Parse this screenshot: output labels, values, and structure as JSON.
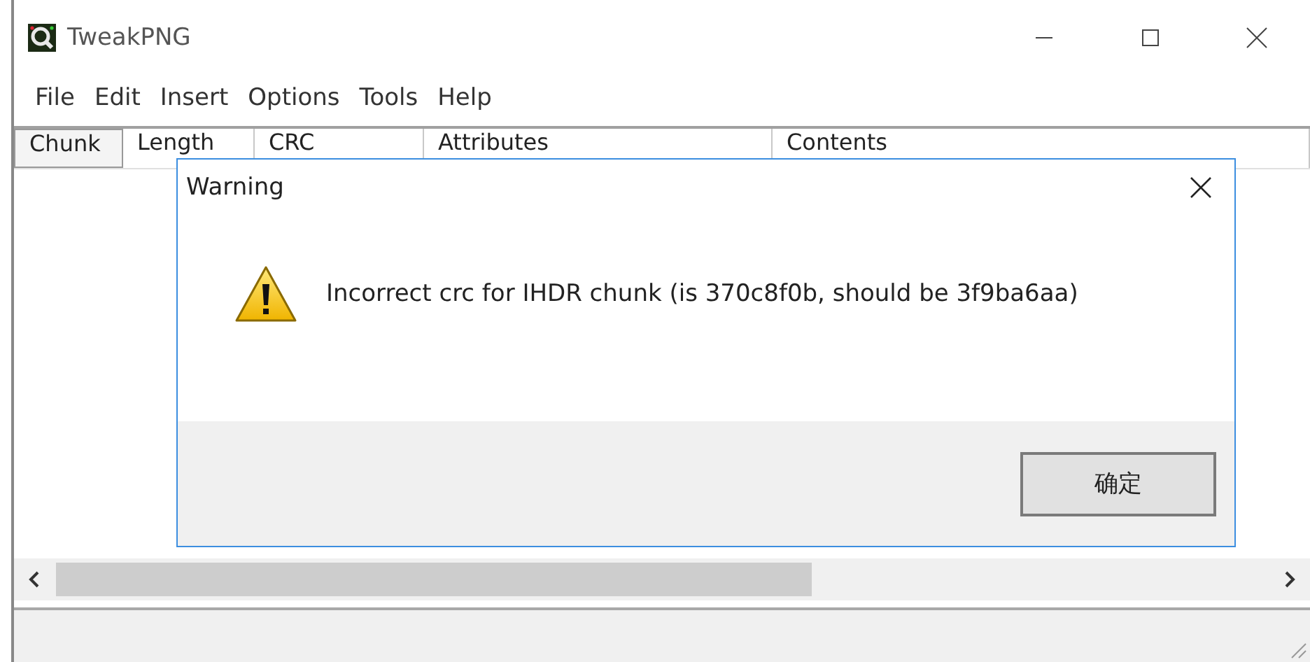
{
  "window": {
    "title": "TweakPNG"
  },
  "menu": [
    "File",
    "Edit",
    "Insert",
    "Options",
    "Tools",
    "Help"
  ],
  "table": {
    "columns": [
      "Chunk",
      "Length",
      "CRC",
      "Attributes",
      "Contents"
    ]
  },
  "dialog": {
    "title": "Warning",
    "kind": "warning",
    "message": "Incorrect crc for IHDR chunk (is 370c8f0b, should be 3f9ba6aa)",
    "buttons": [
      "确定"
    ]
  }
}
